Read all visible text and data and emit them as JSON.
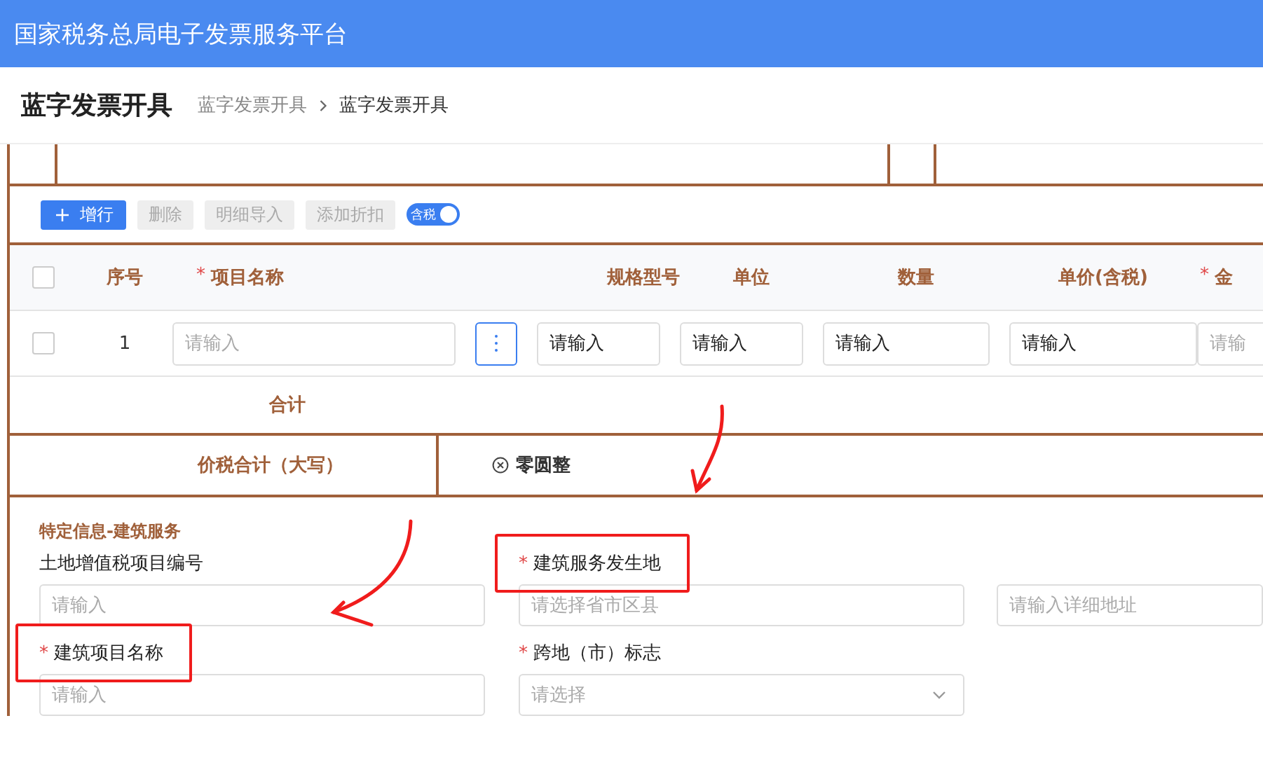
{
  "header": {
    "title": "国家税务总局电子发票服务平台"
  },
  "page": {
    "title": "蓝字发票开具",
    "breadcrumb": [
      {
        "label": "蓝字发票开具",
        "selected": false
      },
      {
        "label": "蓝字发票开具",
        "selected": true
      }
    ]
  },
  "toolbar": {
    "buttons": [
      {
        "label": "增行",
        "kind": "add",
        "disabled": false
      },
      {
        "label": "删除",
        "kind": "plain",
        "disabled": true
      },
      {
        "label": "明细导入",
        "kind": "plain",
        "disabled": true
      },
      {
        "label": "添加折扣",
        "kind": "plain",
        "disabled": true
      }
    ],
    "tax_switch": {
      "label": "含税",
      "on": true
    }
  },
  "table": {
    "header_checked": false,
    "columns": [
      {
        "label": "序号"
      },
      {
        "label": "项目名称",
        "marker": "*"
      },
      {
        "label": "规格型号"
      },
      {
        "label": "单位"
      },
      {
        "label": "数量"
      },
      {
        "label": "单价(含税)"
      },
      {
        "label": "金",
        "marker": "*"
      }
    ],
    "rows": [
      {
        "checked": false,
        "cells": [
          {
            "kind": "text",
            "value": "1"
          },
          {
            "kind": "input",
            "placeholder": "请输入"
          },
          {
            "kind": "input",
            "value": "请输入"
          },
          {
            "kind": "input",
            "value": "请输入"
          },
          {
            "kind": "input",
            "value": "请输入"
          },
          {
            "kind": "input",
            "value": "请输入"
          },
          {
            "kind": "input",
            "placeholder": "请输"
          }
        ]
      }
    ]
  },
  "totals": {
    "label": "合计"
  },
  "amount_in_words": {
    "label": "价税合计（大写）",
    "value": "零圆整"
  },
  "section": {
    "title": "特定信息-建筑服务",
    "fields": [
      {
        "label": "土地增值税项目编号",
        "kind": "text",
        "placeholder": "请输入",
        "highlighted": false
      },
      {
        "label": "建筑服务发生地",
        "marker": "*",
        "kind": "address",
        "placeholder": "请选择省市区县",
        "detail_placeholder": "请输入详细地址",
        "highlighted": true
      },
      {
        "label": "建筑项目名称",
        "marker": "*",
        "kind": "text",
        "placeholder": "请输入",
        "highlighted": true
      },
      {
        "label": "跨地（市）标志",
        "marker": "*",
        "kind": "select",
        "placeholder": "请选择",
        "highlighted": false
      }
    ]
  }
}
